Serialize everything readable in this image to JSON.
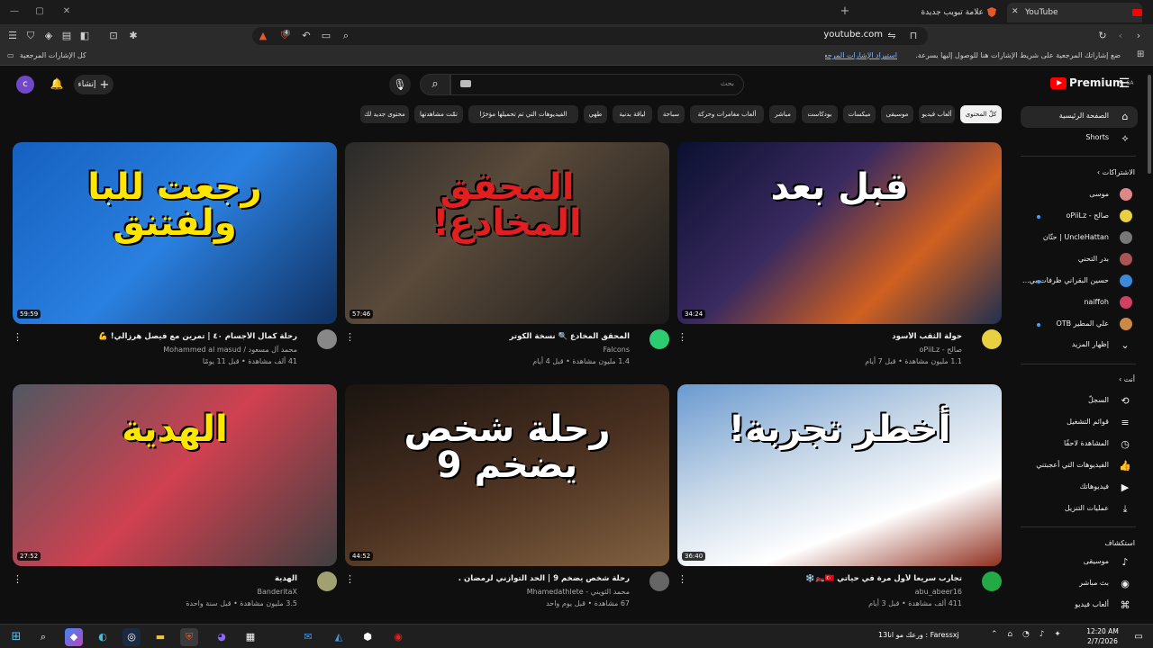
{
  "browser": {
    "tabs": [
      {
        "title": "YouTube",
        "active": true
      },
      {
        "title": "علامة تبويب جديدة",
        "active": false
      }
    ],
    "new_tab": "+",
    "url": "youtube.com",
    "shield_count": "4",
    "bookmarks_hint": "ضع إشاراتك المرجعية على شريط الإشارات هنا للوصول إليها بسرعة.",
    "bookmarks_import": "استيراد الإشارات المرجعية الآن...",
    "bookmarks_all": "كل الإشارات المرجعية"
  },
  "header": {
    "logo_text": "Premium",
    "logo_sup": "SA",
    "search_placeholder": "بحث",
    "create_label": "إنشاء",
    "avatar_letter": "c"
  },
  "chips": [
    "كلّ المحتوى",
    "ألعاب فيديو",
    "موسيقى",
    "ميكسات",
    "بودكاست",
    "مباشر",
    "ألعاب مغامرات وحركة",
    "سباحة",
    "لياقة بدنية",
    "طهي",
    "الفيديوهات التي تم تحميلها مؤخرًا",
    "تمّت مشاهدتها",
    "محتوى جديد لك"
  ],
  "sidebar": {
    "home": "الصفحة الرئيسية",
    "shorts": "Shorts",
    "subs_header": "الاشتراكات",
    "subs": [
      {
        "name": "موسى",
        "color": "#d88",
        "dot": false
      },
      {
        "name": "صالح - oPiiLz",
        "color": "#e8d040",
        "dot": true
      },
      {
        "name": "UncleHattan | حتّان",
        "color": "#777",
        "dot": false
      },
      {
        "name": "بدر التحني",
        "color": "#a55",
        "dot": false
      },
      {
        "name": "حسين البقراني ظرفات بي...",
        "color": "#3a8ad8",
        "dot": true
      },
      {
        "name": "naiffoh",
        "color": "#d04060",
        "dot": false
      },
      {
        "name": "علي المطير OTB",
        "color": "#c84",
        "dot": true
      }
    ],
    "show_more": "إظهار المزيد",
    "you_header": "أنت",
    "you_items": [
      {
        "label": "السجلّ",
        "icon": "⟲"
      },
      {
        "label": "قوائم التشغيل",
        "icon": "≡"
      },
      {
        "label": "المشاهدة لاحقًا",
        "icon": "◷"
      },
      {
        "label": "الفيديوهات التي أعجبتني",
        "icon": "👍"
      },
      {
        "label": "فيديوهاتك",
        "icon": "▶"
      },
      {
        "label": "عمليات التنزيل",
        "icon": "⤓"
      }
    ],
    "explore_header": "استكشاف",
    "explore_items": [
      {
        "label": "موسيقى",
        "icon": "♪"
      },
      {
        "label": "بث مباشر",
        "icon": "◉"
      },
      {
        "label": "ألعاب فيديو",
        "icon": "⌘"
      }
    ]
  },
  "videos": [
    {
      "title": "حولة الثقب الأسود",
      "channel": "صالح - oPiiLz",
      "meta": "1.1 مليون مشاهدة • قبل 7 أيام",
      "duration": "34:24",
      "thumb_text": "قبل  بعد",
      "bg": "linear-gradient(135deg,#0a1030 0%,#3a2a60 40%,#d06020 70%,#203050 100%)",
      "text_color": "#ffffff",
      "avatar": "#e8d040"
    },
    {
      "title": "المحقق المخادع 🔍 نسخة الكوتر",
      "channel": "Falcons",
      "meta": "1.4 مليون مشاهدة • قبل 4 أيام",
      "duration": "57:46",
      "thumb_text": "المحقق المخادع!",
      "bg": "linear-gradient(135deg,#2a2a2a 0%,#5a4a3a 40%,#1a1a1a 100%)",
      "text_color": "#e02020",
      "avatar": "#2ecc71"
    },
    {
      "title": "رحلة كمال الأجسام ٤٠ | تمرين مع فيصل هرزالي! 💪",
      "channel": "محمد آل مسعود / Mohammed al masud",
      "meta": "41 ألف مشاهدة • قبل 11 يومًا",
      "duration": "59:59",
      "thumb_text": "رجعت للبا ولفتنق",
      "bg": "linear-gradient(135deg,#1560c0 0%,#2a80e0 50%,#103060 100%)",
      "text_color": "#ffe600",
      "avatar": "#888"
    },
    {
      "title": "تجارب سريعا لأول مرة في حياتي 🇹🇷🏍️❄️",
      "channel": "abu_abeer16",
      "meta": "411 ألف مشاهدة • قبل 3 أيام",
      "duration": "36:40",
      "thumb_text": "أخطر تجربة!",
      "bg": "linear-gradient(160deg,#6a9ad0 0%,#c8d8e8 40%,#ffffff 70%,#903020 100%)",
      "text_color": "#ffffff",
      "avatar": "#22aa44"
    },
    {
      "title": "رحلة شخص يضخم 9 | الحد التوازني لرمضان .",
      "channel": "محمد الثويني - Mhamedathlete",
      "meta": "67 مشاهدة • قبل يوم واحد",
      "duration": "44:52",
      "thumb_text": "رحلة شخص يضخم 9",
      "bg": "linear-gradient(160deg,#1a1410 0%,#4a3020 50%,#806040 100%)",
      "text_color": "#ffffff",
      "avatar": "#666"
    },
    {
      "title": "الهدية",
      "channel": "BanderitaX",
      "meta": "3.5 مليون مشاهدة • قبل سنة واحدة",
      "duration": "27:52",
      "thumb_text": "الهدية",
      "bg": "linear-gradient(135deg,#505860 0%,#d04050 50%,#404040 100%)",
      "text_color": "#ffe600",
      "avatar": "#a0a070"
    }
  ],
  "taskbar": {
    "ticker": "ورعك مو انا13 : Faressxj",
    "time": "12:20 AM",
    "date": "2/7/2026"
  }
}
